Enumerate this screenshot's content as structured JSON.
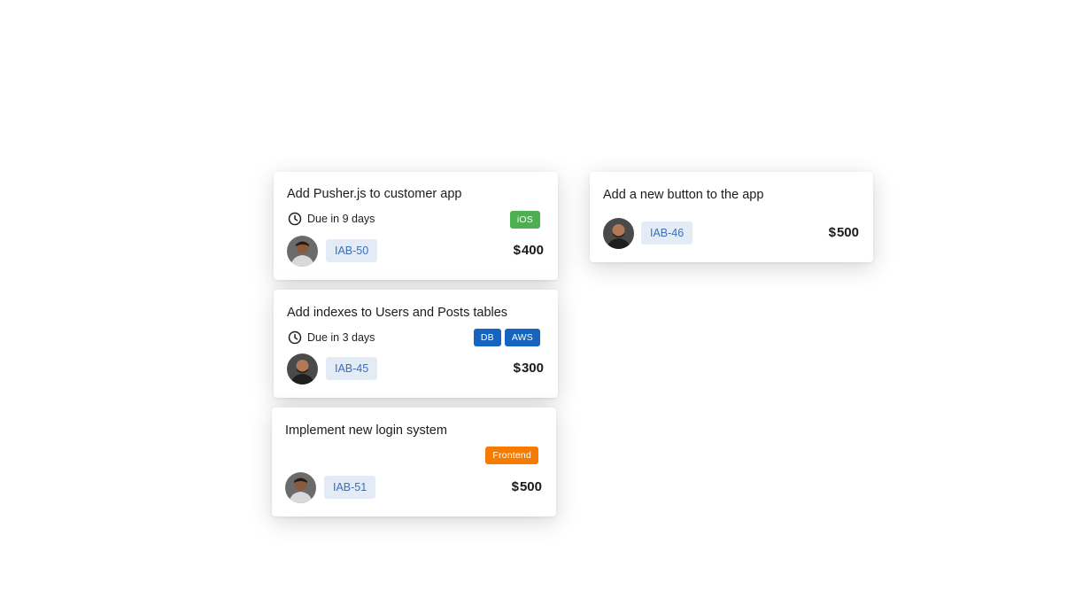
{
  "cards": [
    {
      "title": "Add Pusher.js to customer app",
      "due": "Due in 9 days",
      "tags": [
        {
          "label": "iOS",
          "color": "#4caf50"
        }
      ],
      "id": "IAB-50",
      "currency": "$",
      "amount": "400",
      "avatar": "avatar-person-a"
    },
    {
      "title": "Add indexes to Users and Posts tables",
      "due": "Due in 3 days",
      "tags": [
        {
          "label": "DB",
          "color": "#1565c0"
        },
        {
          "label": "AWS",
          "color": "#1565c0"
        }
      ],
      "id": "IAB-45",
      "currency": "$",
      "amount": "300",
      "avatar": "avatar-person-b"
    },
    {
      "title": "Implement new login system",
      "tags": [
        {
          "label": "Frontend",
          "color": "#f57c00"
        }
      ],
      "id": "IAB-51",
      "currency": "$",
      "amount": "500",
      "avatar": "avatar-person-a"
    },
    {
      "title": "Add a new button to the app",
      "id": "IAB-46",
      "currency": "$",
      "amount": "500",
      "avatar": "avatar-person-b"
    }
  ],
  "icons": {
    "clock": "clock-icon"
  }
}
